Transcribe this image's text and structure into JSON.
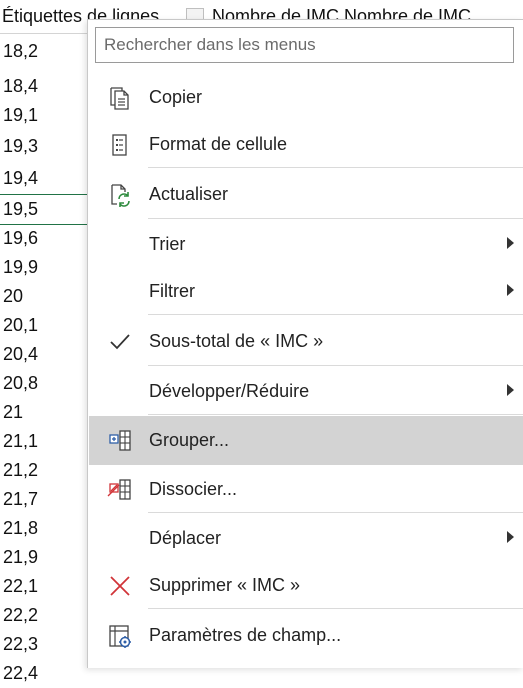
{
  "sheet": {
    "header": {
      "col_a": "Étiquettes de lignes",
      "col_b": "Nombre de IMC",
      "col_c": "Nombre de IMC"
    },
    "rows": [
      "18,2",
      "18,4",
      "19,1",
      "19,3",
      "19,4",
      "19,5",
      "19,6",
      "19,9",
      "20",
      "20,1",
      "20,4",
      "20,8",
      "21",
      "21,1",
      "21,2",
      "21,7",
      "21,8",
      "21,9",
      "22,1",
      "22,2",
      "22,3",
      "22,4"
    ],
    "selected_row": "19,5",
    "selection_color": "#217346"
  },
  "menu": {
    "search_placeholder": "Rechercher dans les menus",
    "highlight_color": "#d3d3d3",
    "items": [
      {
        "label": "Copier",
        "icon": "copy-icon",
        "has_submenu": false
      },
      {
        "label": "Format de cellule",
        "icon": "format-cells-icon",
        "has_submenu": false
      },
      {
        "label": "Actualiser",
        "icon": "refresh-icon",
        "has_submenu": false
      },
      {
        "label": "Trier",
        "icon": "",
        "has_submenu": true
      },
      {
        "label": "Filtrer",
        "icon": "",
        "has_submenu": true
      },
      {
        "label": "Sous-total de « IMC »",
        "icon": "checkmark-icon",
        "has_submenu": false
      },
      {
        "label": "Développer/Réduire",
        "icon": "",
        "has_submenu": true
      },
      {
        "label": "Grouper...",
        "icon": "group-icon",
        "has_submenu": false,
        "highlighted": true
      },
      {
        "label": "Dissocier...",
        "icon": "ungroup-icon",
        "has_submenu": false
      },
      {
        "label": "Déplacer",
        "icon": "",
        "has_submenu": true
      },
      {
        "label": "Supprimer « IMC »",
        "icon": "remove-x-icon",
        "has_submenu": false
      },
      {
        "label": "Paramètres de champ...",
        "icon": "field-settings-icon",
        "has_submenu": false
      }
    ]
  }
}
